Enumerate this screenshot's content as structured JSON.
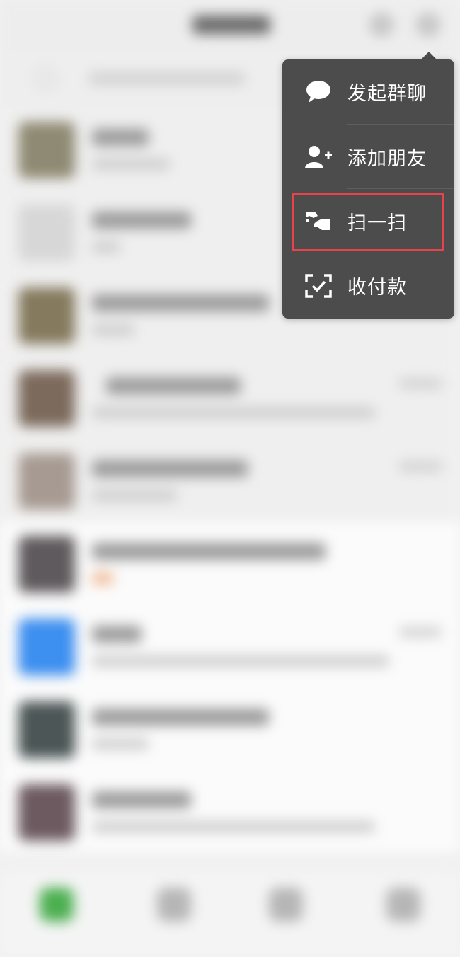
{
  "popup_menu": {
    "items": [
      {
        "label": "发起群聊",
        "icon": "chat-bubble-icon"
      },
      {
        "label": "添加朋友",
        "icon": "add-friend-icon"
      },
      {
        "label": "扫一扫",
        "icon": "scan-icon"
      },
      {
        "label": "收付款",
        "icon": "payment-scan-icon"
      }
    ]
  },
  "colors": {
    "menu_background": "#4c4c4c",
    "menu_text": "#ffffff",
    "highlight_border": "#e8434a",
    "background": "#f1f1f1"
  }
}
